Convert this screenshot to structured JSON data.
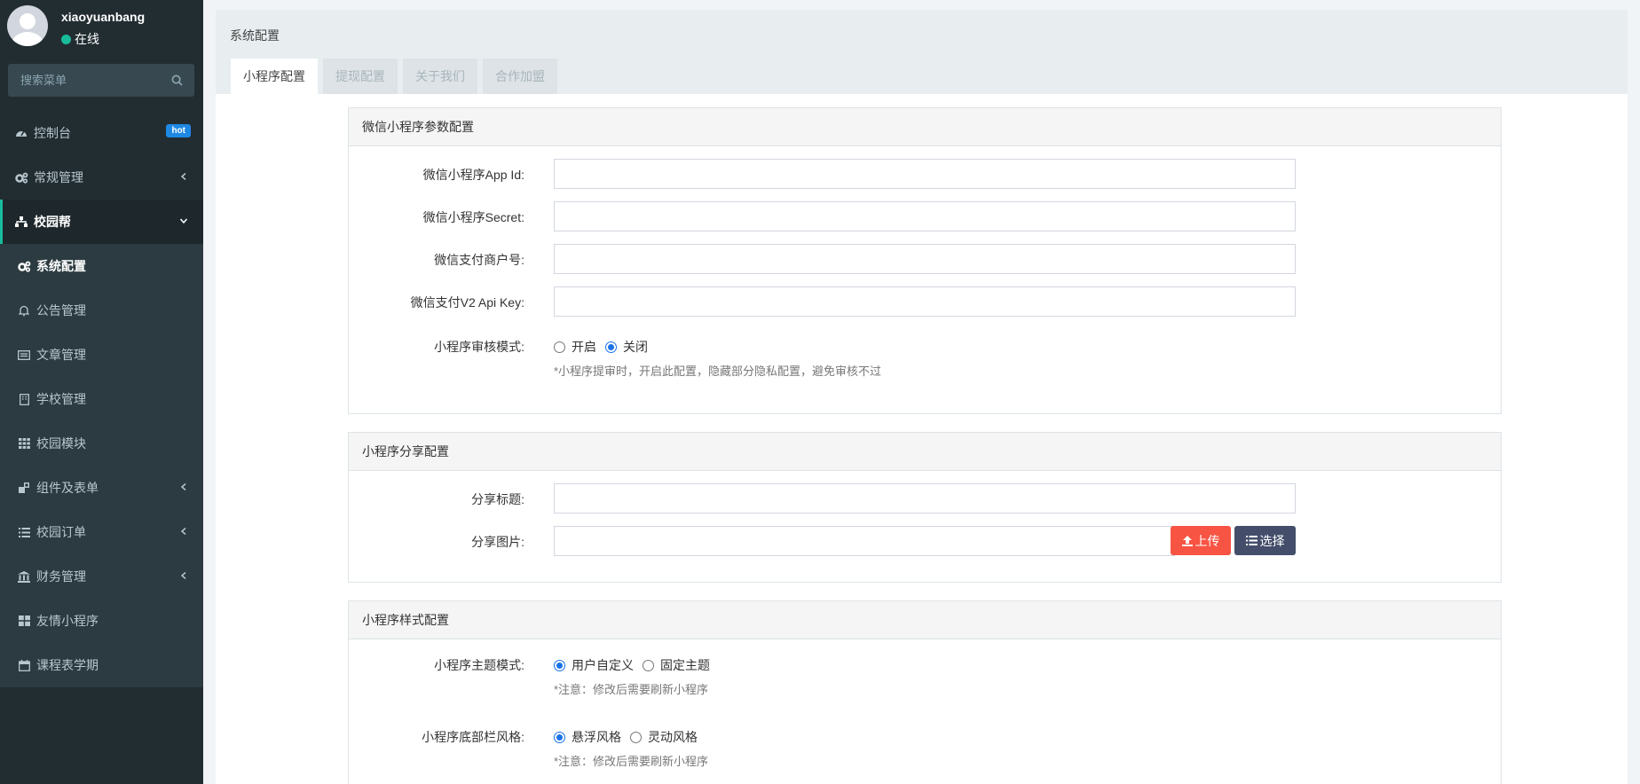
{
  "user": {
    "name": "xiaoyuanbang",
    "status": "在线"
  },
  "search": {
    "placeholder": "搜索菜单"
  },
  "menu": {
    "dashboard": {
      "label": "控制台",
      "badge": "hot"
    },
    "general": {
      "label": "常规管理"
    },
    "campus": {
      "label": "校园帮"
    },
    "sub": [
      {
        "label": "系统配置"
      },
      {
        "label": "公告管理"
      },
      {
        "label": "文章管理"
      },
      {
        "label": "学校管理"
      },
      {
        "label": "校园模块"
      },
      {
        "label": "组件及表单"
      },
      {
        "label": "校园订单"
      },
      {
        "label": "财务管理"
      },
      {
        "label": "友情小程序"
      },
      {
        "label": "课程表学期"
      }
    ]
  },
  "page": {
    "title": "系统配置",
    "tabs": [
      "小程序配置",
      "提现配置",
      "关于我们",
      "合作加盟"
    ]
  },
  "wechat": {
    "header": "微信小程序参数配置",
    "app_id_label": "微信小程序App Id:",
    "secret_label": "微信小程序Secret:",
    "mch_label": "微信支付商户号:",
    "apikey_label": "微信支付V2 Api Key:",
    "review_label": "小程序审核模式:",
    "review_on": "开启",
    "review_off": "关闭",
    "review_selected": "关闭",
    "review_hint": "*小程序提审时，开启此配置，隐藏部分隐私配置，避免审核不过"
  },
  "share": {
    "header": "小程序分享配置",
    "title_label": "分享标题:",
    "image_label": "分享图片:",
    "upload_btn": "上传",
    "select_btn": "选择"
  },
  "style": {
    "header": "小程序样式配置",
    "theme_label": "小程序主题模式:",
    "theme_custom": "用户自定义",
    "theme_fixed": "固定主题",
    "theme_selected": "用户自定义",
    "theme_hint": "*注意：修改后需要刷新小程序",
    "tabbar_label": "小程序底部栏风格:",
    "tabbar_float": "悬浮风格",
    "tabbar_dynamic": "灵动风格",
    "tabbar_selected": "悬浮风格",
    "tabbar_hint": "*注意：修改后需要刷新小程序"
  },
  "colors": {
    "sidebar": "#222d32",
    "accent": "#18bc9c",
    "upload": "#f75444",
    "select": "#444e6b",
    "badge": "#1e88e5"
  }
}
